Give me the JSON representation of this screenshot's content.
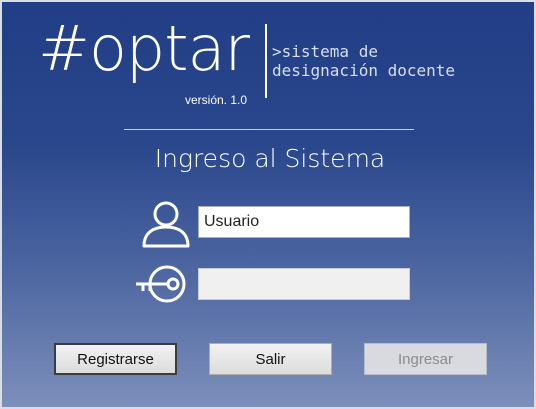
{
  "app": {
    "logo_text": "#optar",
    "version_text": "versión. 1.0",
    "subtitle_line1": ">sistema de",
    "subtitle_line2": "designación docente"
  },
  "form": {
    "heading": "Ingreso al Sistema",
    "username_value": "Usuario",
    "username_placeholder": "",
    "password_value": "",
    "user_icon": "user-icon",
    "key_icon": "key-icon"
  },
  "buttons": {
    "register_label": "Registrarse",
    "exit_label": "Salir",
    "login_label": "Ingresar",
    "login_enabled": false
  },
  "colors": {
    "background_top": "#213e86",
    "background_bottom": "#7d8fbb",
    "foreground": "#ffffff"
  }
}
